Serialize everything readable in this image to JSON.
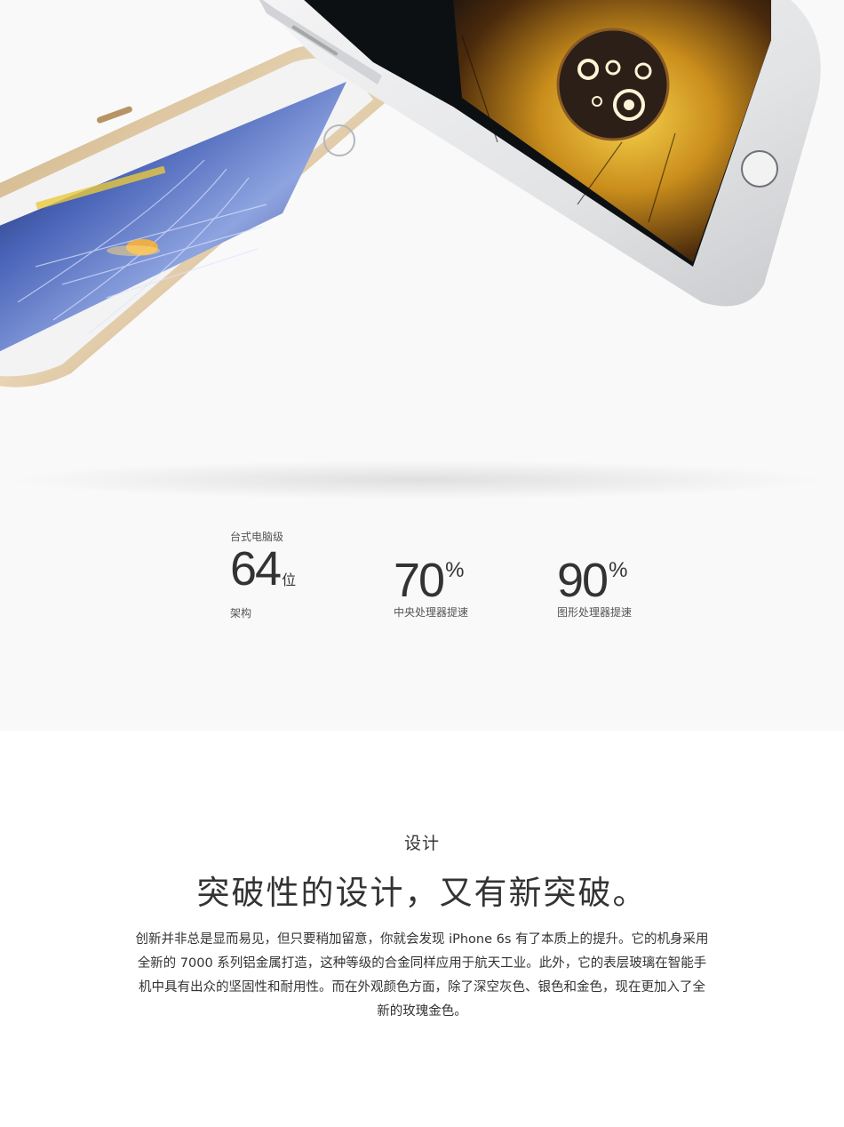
{
  "stats": [
    {
      "top_label": "台式电脑级",
      "value": "64",
      "unit": "位",
      "caption": "架构"
    },
    {
      "value": "70",
      "unit": "%",
      "caption": "中央处理器提速"
    },
    {
      "value": "90",
      "unit": "%",
      "caption": "图形处理器提速"
    }
  ],
  "design": {
    "eyebrow": "设计",
    "headline": "突破性的设计，又有新突破。",
    "body": "创新并非总是显而易见，但只要稍加留意，你就会发现 iPhone 6s 有了本质上的提升。它的机身采用全新的 7000 系列铝金属打造，这种等级的合金同样应用于航天工业。此外，它的表层玻璃在智能手机中具有出众的坚固性和耐用性。而在外观颜色方面，除了深空灰色、银色和金色，现在更加入了全新的玫瑰金色。"
  },
  "colors": {
    "hero_bg": "#f9f9f9",
    "gold_phone": "#d8c2a0",
    "silver_phone": "#e6e7e9",
    "text": "#333333"
  },
  "images": {
    "left_phone": "gold-iphone-racing-game-image",
    "right_phone": "silver-iphone-space-game-image"
  }
}
